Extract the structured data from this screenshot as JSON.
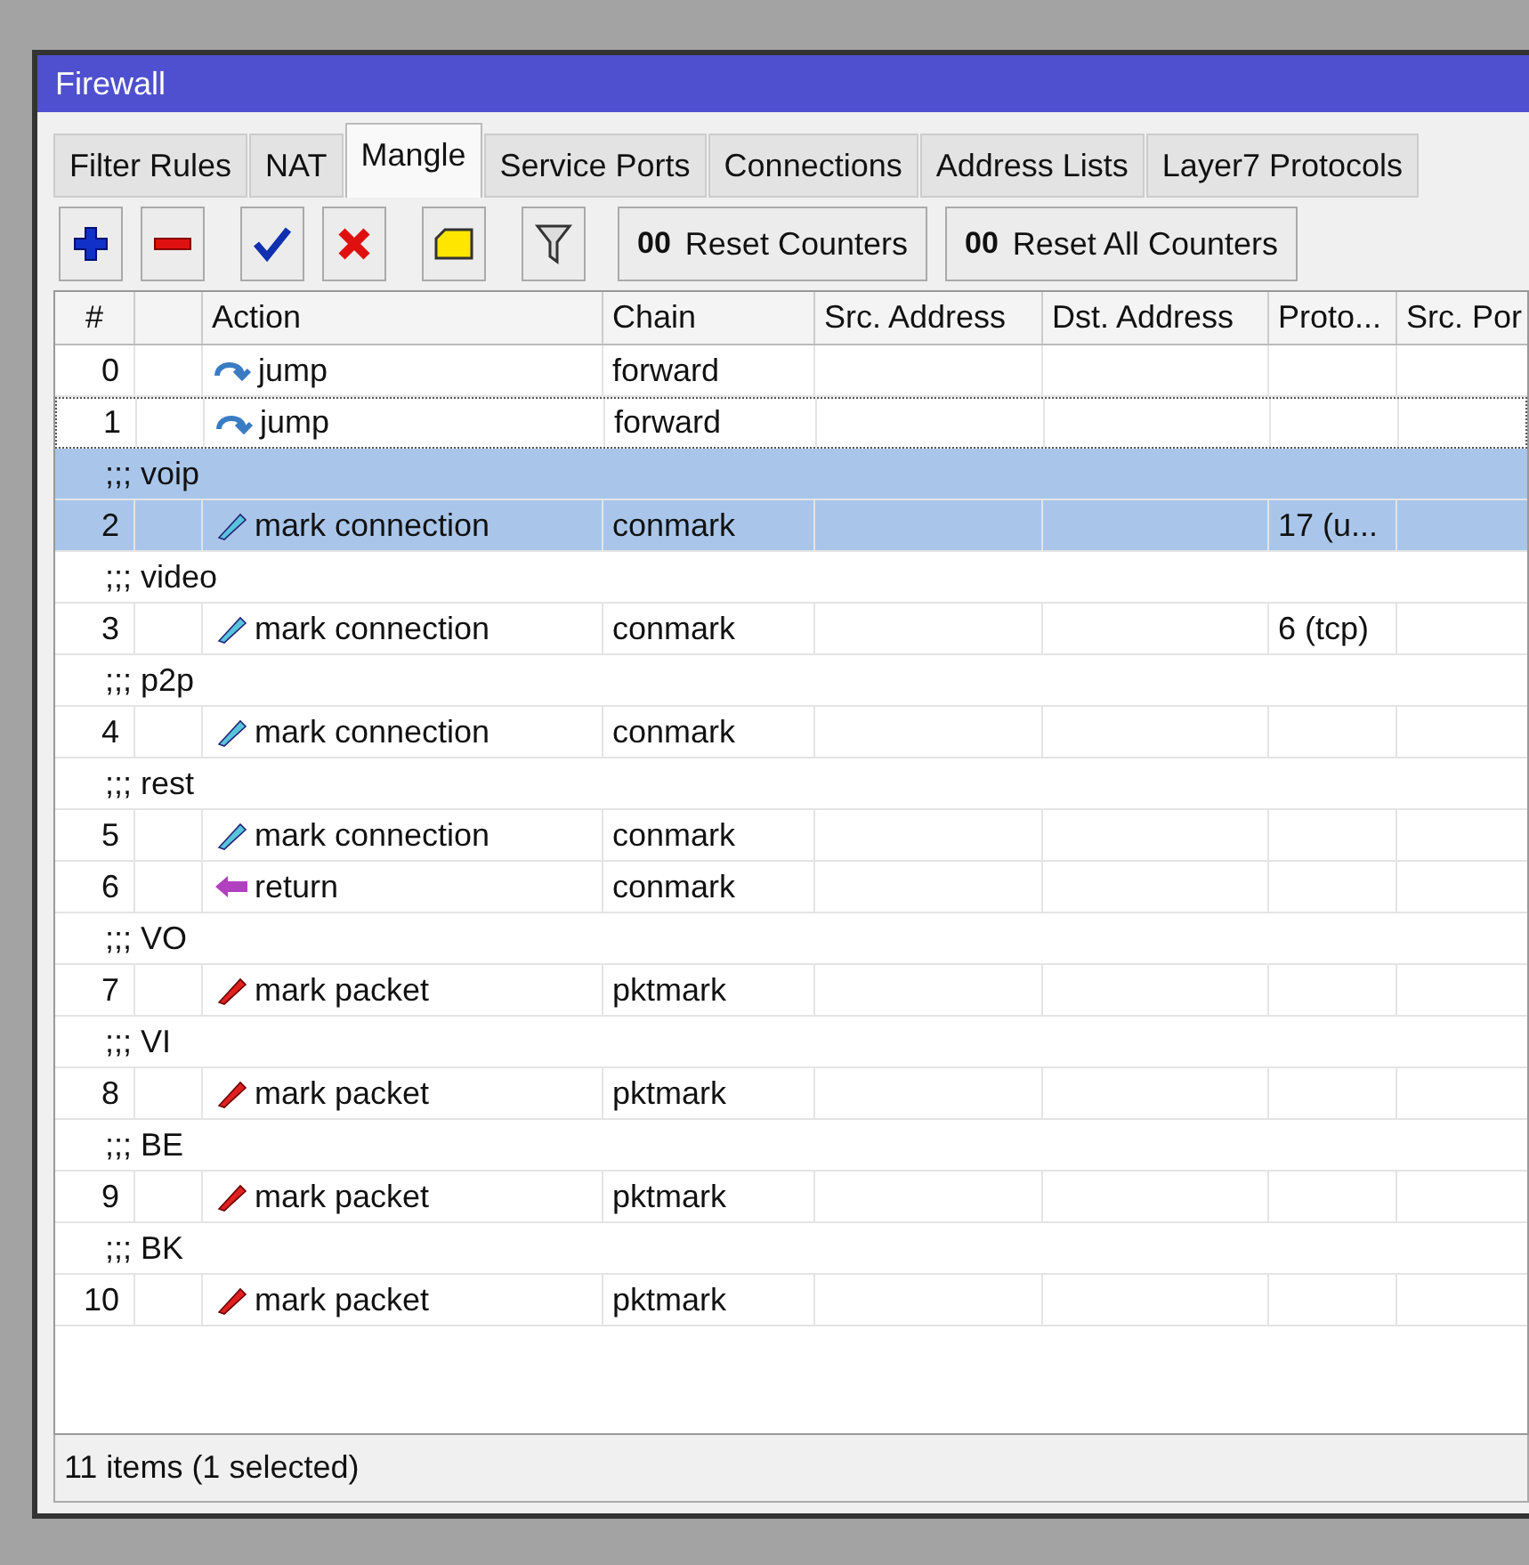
{
  "window": {
    "title": "Firewall"
  },
  "tabs": [
    {
      "label": "Filter Rules",
      "selected": false
    },
    {
      "label": "NAT",
      "selected": false
    },
    {
      "label": "Mangle",
      "selected": true
    },
    {
      "label": "Service Ports",
      "selected": false
    },
    {
      "label": "Connections",
      "selected": false
    },
    {
      "label": "Address Lists",
      "selected": false
    },
    {
      "label": "Layer7 Protocols",
      "selected": false
    }
  ],
  "toolbar": [
    {
      "kind": "add"
    },
    {
      "kind": "remove"
    },
    {
      "kind": "enable"
    },
    {
      "kind": "disable"
    },
    {
      "kind": "comment"
    },
    {
      "kind": "filter"
    },
    {
      "kind": "text",
      "glyph": "00",
      "label": "Reset Counters"
    },
    {
      "kind": "text",
      "glyph": "00",
      "label": "Reset All Counters"
    }
  ],
  "table": {
    "columns": [
      "#",
      "Action",
      "Chain",
      "Src. Address",
      "Dst. Address",
      "Proto...",
      "Src. Por"
    ],
    "rows": [
      {
        "kind": "jump",
        "number": "0",
        "action": "jump",
        "chain": "forward",
        "protocol": "",
        "selected": false,
        "focused": false
      },
      {
        "kind": "jump",
        "number": "1",
        "action": "jump",
        "chain": "forward",
        "protocol": "",
        "selected": false,
        "focused": true
      },
      {
        "kind": "comment",
        "text": ";;; voip",
        "selected": true,
        "focused": false
      },
      {
        "kind": "mark-connection",
        "number": "2",
        "action": "mark connection",
        "chain": "conmark",
        "protocol": "17 (u...",
        "selected": true,
        "focused": false
      },
      {
        "kind": "comment",
        "text": ";;; video",
        "selected": false,
        "focused": false
      },
      {
        "kind": "mark-connection",
        "number": "3",
        "action": "mark connection",
        "chain": "conmark",
        "protocol": "6 (tcp)",
        "selected": false,
        "focused": false
      },
      {
        "kind": "comment",
        "text": ";;; p2p",
        "selected": false,
        "focused": false
      },
      {
        "kind": "mark-connection",
        "number": "4",
        "action": "mark connection",
        "chain": "conmark",
        "protocol": "",
        "selected": false,
        "focused": false
      },
      {
        "kind": "comment",
        "text": ";;; rest",
        "selected": false,
        "focused": false
      },
      {
        "kind": "mark-connection",
        "number": "5",
        "action": "mark connection",
        "chain": "conmark",
        "protocol": "",
        "selected": false,
        "focused": false
      },
      {
        "kind": "return",
        "number": "6",
        "action": "return",
        "chain": "conmark",
        "protocol": "",
        "selected": false,
        "focused": false
      },
      {
        "kind": "comment",
        "text": ";;; VO",
        "selected": false,
        "focused": false
      },
      {
        "kind": "mark-packet",
        "number": "7",
        "action": "mark packet",
        "chain": "pktmark",
        "protocol": "",
        "selected": false,
        "focused": false
      },
      {
        "kind": "comment",
        "text": ";;; VI",
        "selected": false,
        "focused": false
      },
      {
        "kind": "mark-packet",
        "number": "8",
        "action": "mark packet",
        "chain": "pktmark",
        "protocol": "",
        "selected": false,
        "focused": false
      },
      {
        "kind": "comment",
        "text": ";;; BE",
        "selected": false,
        "focused": false
      },
      {
        "kind": "mark-packet",
        "number": "9",
        "action": "mark packet",
        "chain": "pktmark",
        "protocol": "",
        "selected": false,
        "focused": false
      },
      {
        "kind": "comment",
        "text": ";;; BK",
        "selected": false,
        "focused": false
      },
      {
        "kind": "mark-packet",
        "number": "10",
        "action": "mark packet",
        "chain": "pktmark",
        "protocol": "",
        "selected": false,
        "focused": false
      }
    ]
  },
  "status_bar": "11 items (1 selected)"
}
